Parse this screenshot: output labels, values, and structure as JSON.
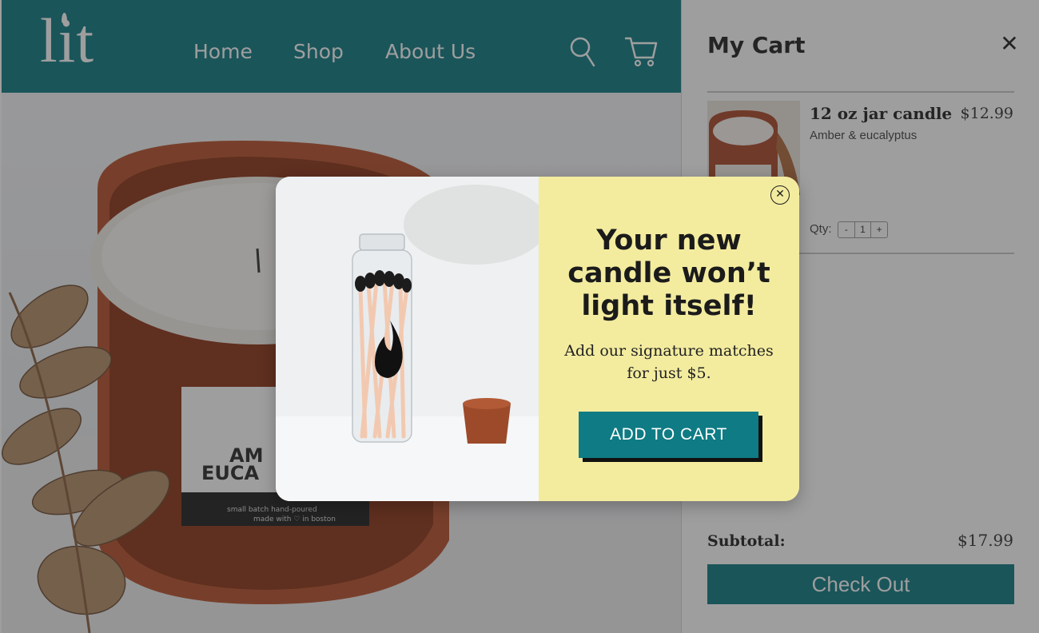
{
  "site": {
    "logo": "lit",
    "nav": [
      "Home",
      "Shop",
      "About Us"
    ],
    "icons": {
      "search": "search-icon",
      "cart": "cart-icon"
    },
    "hero_label_line1": "AM",
    "hero_label_line2": "EUCA",
    "hero_small_line1": "small batch hand-poured",
    "hero_small_line2": "made with ♡ in boston",
    "brand_color": "#0f7b84"
  },
  "cart": {
    "title": "My Cart",
    "close": "✕",
    "item": {
      "name": "12 oz jar candle",
      "variant": "Amber & eucalyptus",
      "price": "$12.99",
      "qty_label": "Qty:",
      "qty_minus": "-",
      "qty_value": "1",
      "qty_plus": "+"
    },
    "subtotal_label": "Subtotal:",
    "subtotal_value": "$17.99",
    "checkout": "Check Out"
  },
  "modal": {
    "close": "✕",
    "headline": "Your new candle won’t light itself!",
    "body": "Add our signature matches for just $5.",
    "button": "ADD TO CART",
    "background": "#f3ec9f"
  }
}
